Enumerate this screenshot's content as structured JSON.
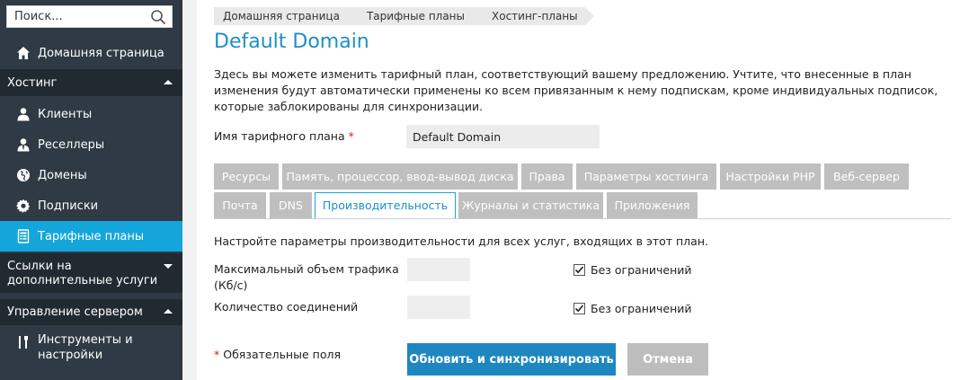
{
  "sidebar": {
    "search_placeholder": "Поиск...",
    "home_label": "Домашняя страница",
    "hosting_section": "Хостинг",
    "hosting_items": [
      {
        "label": "Клиенты",
        "icon": "user-icon"
      },
      {
        "label": "Реселлеры",
        "icon": "reseller-icon"
      },
      {
        "label": "Домены",
        "icon": "globe-icon"
      },
      {
        "label": "Подписки",
        "icon": "gear-icon"
      },
      {
        "label": "Тарифные планы",
        "icon": "plan-icon"
      }
    ],
    "links_section": "Ссылки на дополнительные услуги",
    "server_section": "Управление сервером",
    "tools_label": "Инструменты и настройки",
    "active_color": "#14a6da"
  },
  "breadcrumb": [
    "Домашняя страница",
    "Тарифные планы",
    "Хостинг-планы"
  ],
  "page": {
    "title": "Default Domain",
    "description": "Здесь вы можете изменить тарифный план, соответствующий вашему предложению. Учтите, что внесенные в план изменения будут автоматически применены ко всем привязанным к нему подпискам, кроме индивидуальных подписок, которые заблокированы для синхронизации.",
    "plan_name_label": "Имя тарифного плана",
    "required_mark": "*",
    "plan_name_value": "Default Domain"
  },
  "tabs_row1": [
    "Ресурсы",
    "Память, процессор, ввод-вывод диска",
    "Права",
    "Параметры хостинга",
    "Настройки PHP",
    "Веб-сервер"
  ],
  "tabs_row2": [
    "Почта",
    "DNS",
    "Производительность",
    "Журналы и статистика",
    "Приложения"
  ],
  "active_tab": "Производительность",
  "performance": {
    "intro": "Настройте параметры производительности для всех услуг, входящих в этот план.",
    "traffic_label": "Максимальный объем трафика (Кб/с)",
    "connections_label": "Количество соединений",
    "unlimited_label": "Без ограничений",
    "traffic_unlimited": true,
    "connections_unlimited": true
  },
  "footer": {
    "required_note": "Обязательные поля",
    "update_button": "Обновить и синхронизировать",
    "cancel_button": "Отмена"
  }
}
